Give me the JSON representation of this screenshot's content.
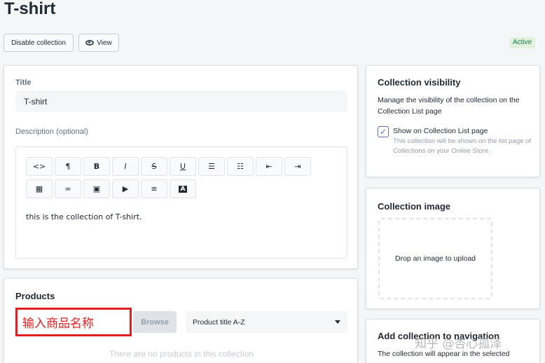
{
  "header": {
    "title": "T-shirt",
    "disable_label": "Disable collection",
    "view_label": "View",
    "status": "Active"
  },
  "main": {
    "title_label": "Title",
    "title_value": "T-shirt",
    "desc_label": "Description (optional)",
    "toolbar": [
      {
        "icon": "code-icon",
        "glyph": "<>"
      },
      {
        "icon": "paragraph-icon",
        "glyph": "¶"
      },
      {
        "icon": "bold-icon",
        "glyph": "B"
      },
      {
        "icon": "italic-icon",
        "glyph": "I"
      },
      {
        "icon": "strikethrough-icon",
        "glyph": "S"
      },
      {
        "icon": "underline-icon",
        "glyph": "U"
      },
      {
        "icon": "bullet-list-icon",
        "glyph": "☰"
      },
      {
        "icon": "numbered-list-icon",
        "glyph": "☷"
      },
      {
        "icon": "outdent-icon",
        "glyph": "⇤"
      },
      {
        "icon": "indent-icon",
        "glyph": "⇥"
      },
      {
        "icon": "table-icon",
        "glyph": "▦"
      },
      {
        "icon": "link-icon",
        "glyph": "∞"
      },
      {
        "icon": "image-icon",
        "glyph": "▣"
      },
      {
        "icon": "video-icon",
        "glyph": "▶"
      },
      {
        "icon": "align-icon",
        "glyph": "≡"
      },
      {
        "icon": "text-color-icon",
        "glyph": "A"
      }
    ],
    "description_text": "this is the collection of T-shirt."
  },
  "products": {
    "heading": "Products",
    "search_value": "输入商品名称",
    "browse_label": "Browse",
    "sort_value": "Product title A-Z",
    "empty_text": "There are no products in this collection"
  },
  "visibility": {
    "heading": "Collection visibility",
    "description": "Manage the visibility of the collection on the Collection List page",
    "checkbox_label": "Show on Collection List page",
    "checkbox_help": "This collection will be shown on the list page of Collections on your Online Store.",
    "checked": true
  },
  "image": {
    "heading": "Collection image",
    "dropzone_text": "Drop an image to upload"
  },
  "navigation": {
    "heading": "Add collection to navigation",
    "description": "The collection will appear in the selected"
  },
  "watermark": "知乎 @杏心孤泽",
  "colors": {
    "accent": "#5c6ac4",
    "active_badge_bg": "#e3f1df",
    "active_badge_text": "#108043",
    "highlight_red": "#e02020"
  }
}
